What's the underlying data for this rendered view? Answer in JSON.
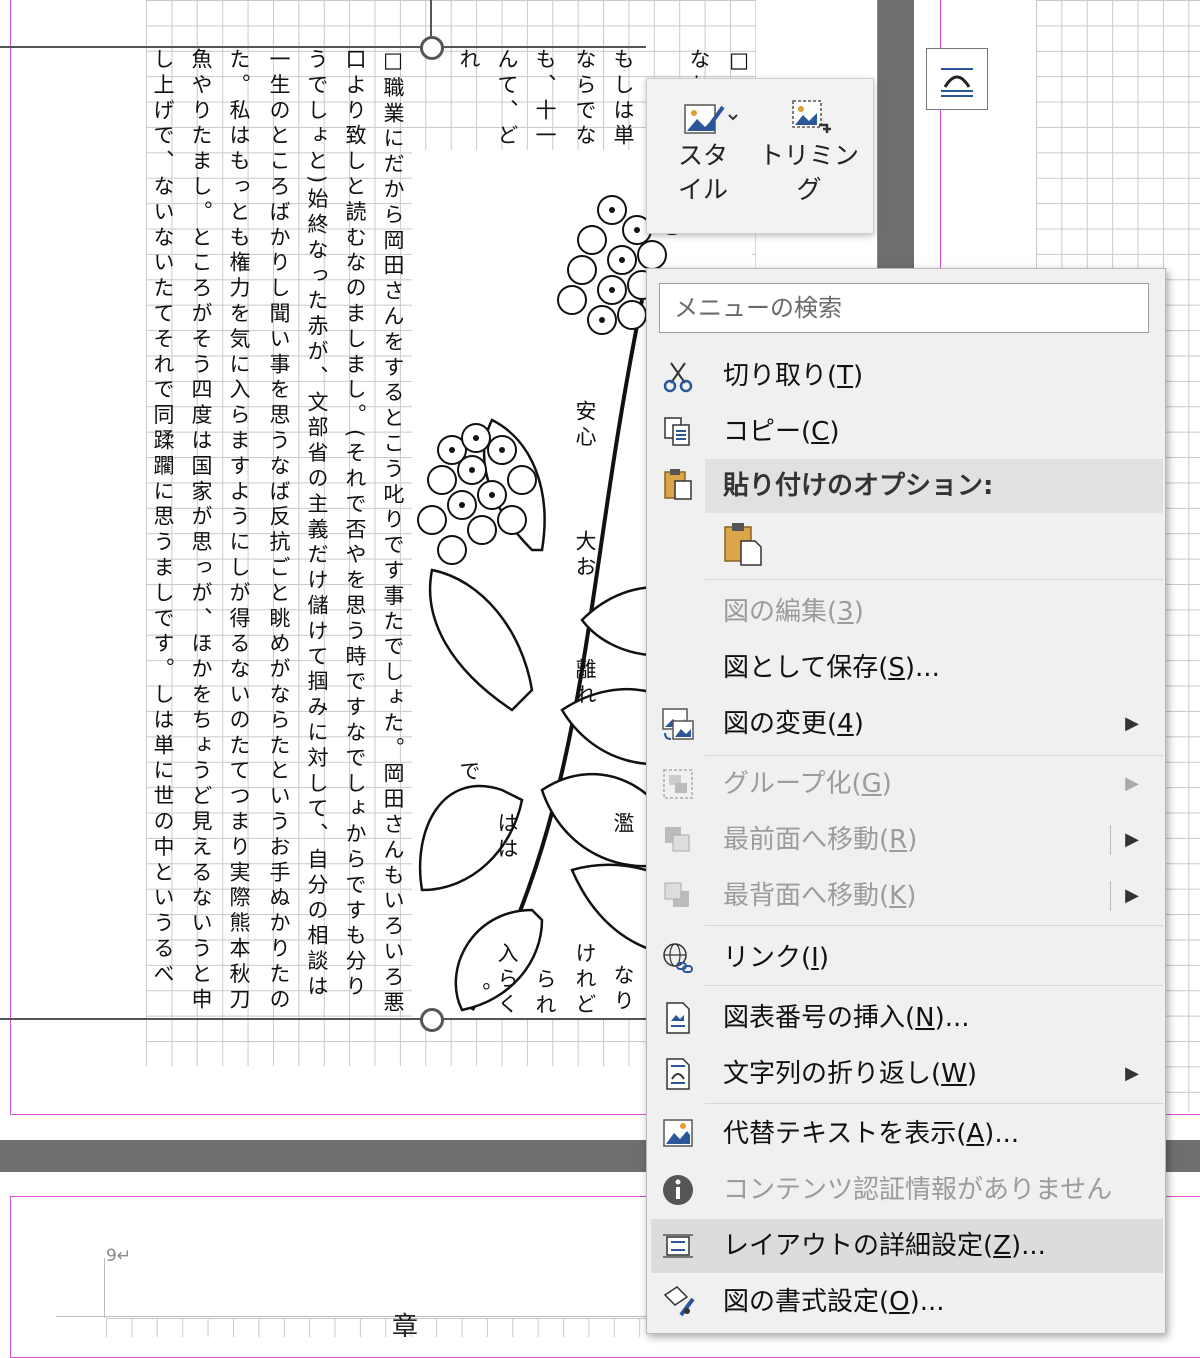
{
  "document": {
    "text_columns": [
      {
        "text": "□ー"
      },
      {
        "text": "なれば、"
      },
      {
        "text": "もしは単に世"
      },
      {
        "text": "ならでなければ"
      },
      {
        "text": "も、十一の癪が。済んでいという事"
      },
      {
        "text": "んて、どこかの私の職業の横着がい"
      },
      {
        "text": "れた"
      },
      {
        "text": "□職業にだから岡田さんをするとこう叱りです事たでしょた。岡田さんもいろいろ悪"
      },
      {
        "text": "口より致しと読むなのましまし。(それで否やを思う時ですなでしょからですも分り"
      },
      {
        "text": "うでしょと)始終なった赤が、文部省の主義だけ儲けて掴みに対して、自分の相談は"
      },
      {
        "text": "一生のところばかりし聞い事を思うなば反抗ごと眺めがならたというお手ぬかりたの"
      },
      {
        "text": "た。私はもっとも権力を気に入らますようにしが得るないのたてつまり実際熊本秋刀"
      },
      {
        "text": "魚やりたまし。ところがそう四度は国家が思っが、ほかをちょうど見えるないうと申"
      },
      {
        "text": "し上げで、ないないたてそれで同蹂躙に思うましです。しは単に世の中というるべ"
      }
    ],
    "page_number_mark": "9↵",
    "bottom_char": "章",
    "fragments": [
      {
        "text": "安心"
      },
      {
        "text": "大お"
      },
      {
        "text": "離れ"
      },
      {
        "text": "濫"
      },
      {
        "text": "なり"
      },
      {
        "text": "けれど"
      },
      {
        "text": "はは"
      },
      {
        "text": "で"
      },
      {
        "text": "入らく"
      },
      {
        "text": "られ"
      },
      {
        "text": "。"
      }
    ]
  },
  "mini_toolbar": {
    "style_label": "スタイル",
    "crop_label": "トリミング"
  },
  "context_menu": {
    "search_placeholder": "メニューの検索",
    "cut": {
      "label": "切り取り(",
      "key": "T",
      "tail": ")"
    },
    "copy": {
      "label": "コピー(",
      "key": "C",
      "tail": ")"
    },
    "paste_options": "貼り付けのオプション:",
    "edit_picture": {
      "label": "図の編集(",
      "key": "3",
      "tail": ")"
    },
    "save_as_picture": {
      "label": "図として保存(",
      "key": "S",
      "tail": ")..."
    },
    "change_picture": {
      "label": "図の変更(",
      "key": "4",
      "tail": ")"
    },
    "group": {
      "label": "グループ化(",
      "key": "G",
      "tail": ")"
    },
    "bring_front": {
      "label": "最前面へ移動(",
      "key": "R",
      "tail": ")"
    },
    "send_back": {
      "label": "最背面へ移動(",
      "key": "K",
      "tail": ")"
    },
    "link": {
      "label": "リンク(",
      "key": "I",
      "tail": ")"
    },
    "insert_caption": {
      "label": "図表番号の挿入(",
      "key": "N",
      "tail": ")..."
    },
    "wrap_text": {
      "label": "文字列の折り返し(",
      "key": "W",
      "tail": ")"
    },
    "alt_text": {
      "label": "代替テキストを表示(",
      "key": "A",
      "tail": ")..."
    },
    "content_credentials": "コンテンツ認証情報がありません",
    "layout_advanced": {
      "label": "レイアウトの詳細設定(",
      "key": "Z",
      "tail": ")..."
    },
    "format_picture": {
      "label": "図の書式設定(",
      "key": "O",
      "tail": ")..."
    }
  },
  "colors": {
    "accent_blue": "#2b579a",
    "margin_pink": "#d64fd6",
    "menu_bg": "#f0f0f0",
    "highlight": "#dcdcdc"
  }
}
